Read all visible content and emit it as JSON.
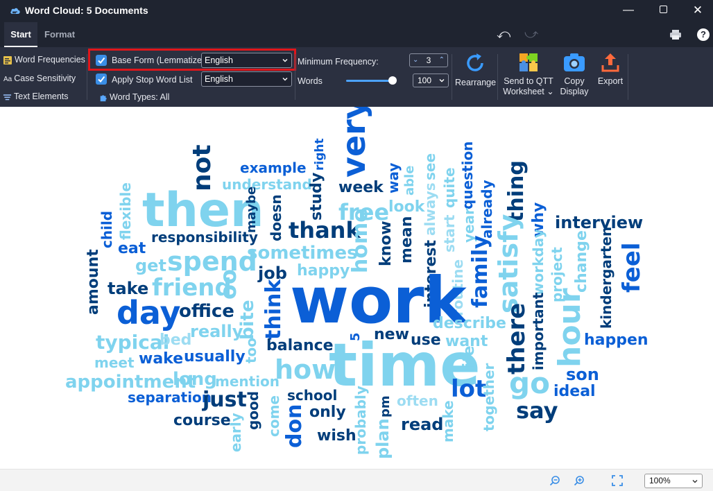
{
  "window": {
    "title": "Word Cloud: 5 Documents"
  },
  "tabs": {
    "start": "Start",
    "format": "Format"
  },
  "ribbon": {
    "word_frequencies": "Word Frequencies",
    "case_sensitivity": "Case Sensitivity",
    "text_elements": "Text Elements",
    "base_form_label": "Base Form (Lemmatize)",
    "base_form_language": "English",
    "stop_word_label": "Apply Stop Word List",
    "stop_word_language": "English",
    "word_types": "Word Types: All",
    "min_frequency_label": "Minimum Frequency:",
    "min_frequency_value": "3",
    "words_label": "Words",
    "words_value": "100",
    "rearrange": "Rearrange",
    "send_to_qtt_1": "Send to QTT",
    "send_to_qtt_2": "Worksheet",
    "copy_1": "Copy",
    "copy_2": "Display",
    "export": "Export"
  },
  "colors": {
    "dark": "#003d7a",
    "medium": "#0b5fd6",
    "mid": "#1677e6",
    "light": "#7fd3ee",
    "pale": "#9cdcf2"
  },
  "cloud": {
    "very": "very",
    "not": "not",
    "example": "example",
    "understand": "understand",
    "right": "right",
    "study": "study",
    "week": "week",
    "way": "way",
    "able": "able",
    "see": "see",
    "quite": "quite",
    "question": "question",
    "already": "already",
    "thing": "thing",
    "then": "then",
    "flexible": "flexible",
    "child": "child",
    "eat": "eat",
    "responsibility": "responsibility",
    "maybe": "maybe",
    "doesn": "doesn",
    "thank": "thank",
    "free": "free",
    "look": "look",
    "always": "always",
    "start": "start",
    "year": "year",
    "why": "why",
    "interview": "interview",
    "spend": "spend",
    "get": "get",
    "sometimes": "sometimes",
    "home": "home",
    "know": "know",
    "mean": "mean",
    "interest": "interest",
    "routine": "routine",
    "family": "family",
    "satisfy": "satisfy",
    "workday": "workday",
    "project": "project",
    "change": "change",
    "kindergarten": "kindergarten",
    "feel": "feel",
    "amount": "amount",
    "take": "take",
    "friend": "friend",
    "oo": "oo",
    "job": "job",
    "happy": "happy",
    "work": "work",
    "day": "day",
    "office": "office",
    "bite": "bite",
    "think": "think",
    "describe": "describe",
    "there": "there",
    "important": "important",
    "hour": "hour",
    "really": "really",
    "typical": "typical",
    "bed": "bed",
    "too": "too",
    "balance": "balance",
    "new": "new",
    "use": "use",
    "want": "want",
    "happen": "happen",
    "meet": "meet",
    "wake": "wake",
    "usually": "usually",
    "time": "time",
    "life": "life",
    "five": "5",
    "appointment": "appointment",
    "long": "long",
    "mention": "mention",
    "how": "how",
    "lot": "lot",
    "together": "together",
    "go": "go",
    "son": "son",
    "separation": "separation",
    "just": "just",
    "school": "school",
    "often": "often",
    "ideal": "ideal",
    "say": "say",
    "course": "course",
    "early": "early",
    "good": "good",
    "come": "come",
    "don": "don",
    "only": "only",
    "probably": "probably",
    "plan": "plan",
    "pm": "pm",
    "read": "read",
    "make": "make",
    "wish": "wish"
  },
  "statusbar": {
    "zoom": "100%"
  }
}
